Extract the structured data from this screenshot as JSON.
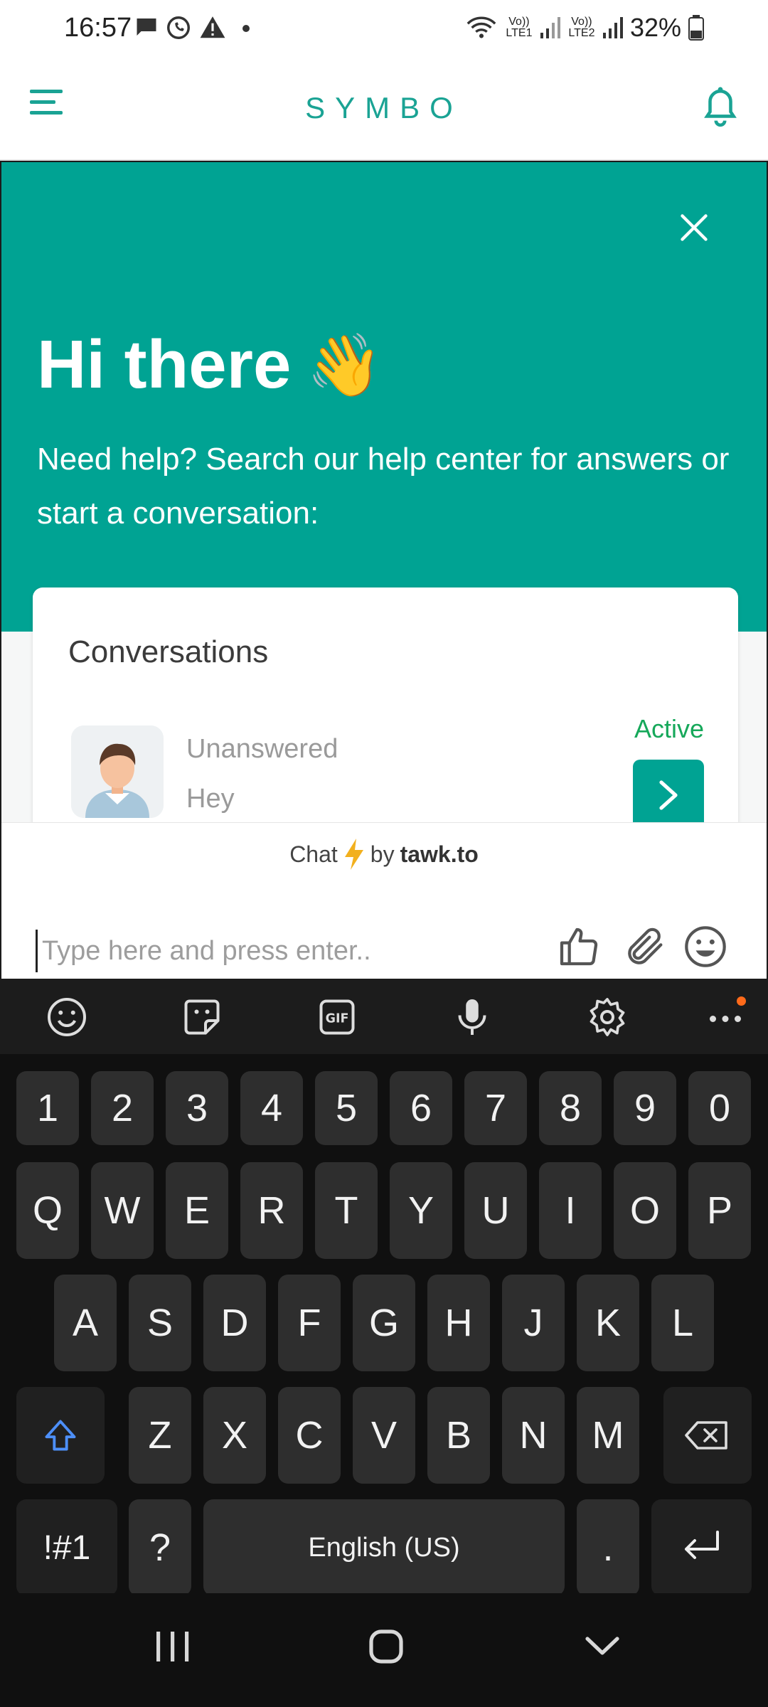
{
  "status_bar": {
    "time": "16:57",
    "battery": "32%",
    "sim1": "Vo)) LTE1",
    "sim2": "Vo)) LTE2"
  },
  "header": {
    "brand": "SYMBO",
    "menu_icon": "hamburger-icon",
    "notification_icon": "bell-icon"
  },
  "widget": {
    "greeting": "Hi there",
    "greeting_emoji": "👋",
    "subtitle": "Need help? Search our help center for answers or start a conversation:",
    "conversations": {
      "title": "Conversations",
      "items": [
        {
          "status": "Unanswered",
          "message": "Hey",
          "state": "Active"
        }
      ]
    },
    "powered_by": {
      "chat": "Chat",
      "by": "by",
      "brand": "tawk.to"
    },
    "composer": {
      "placeholder": "Type here and press enter..",
      "value": ""
    }
  },
  "keyboard": {
    "row_numbers": [
      "1",
      "2",
      "3",
      "4",
      "5",
      "6",
      "7",
      "8",
      "9",
      "0"
    ],
    "row1": [
      "Q",
      "W",
      "E",
      "R",
      "T",
      "Y",
      "U",
      "I",
      "O",
      "P"
    ],
    "row2": [
      "A",
      "S",
      "D",
      "F",
      "G",
      "H",
      "J",
      "K",
      "L"
    ],
    "row3": [
      "Z",
      "X",
      "C",
      "V",
      "B",
      "N",
      "M"
    ],
    "symbols_label": "!#1",
    "question_label": "?",
    "space_label": "English (US)",
    "period_label": "."
  },
  "colors": {
    "accent": "#00a393",
    "active_green": "#16a85a",
    "keyboard_bg": "#101010"
  }
}
